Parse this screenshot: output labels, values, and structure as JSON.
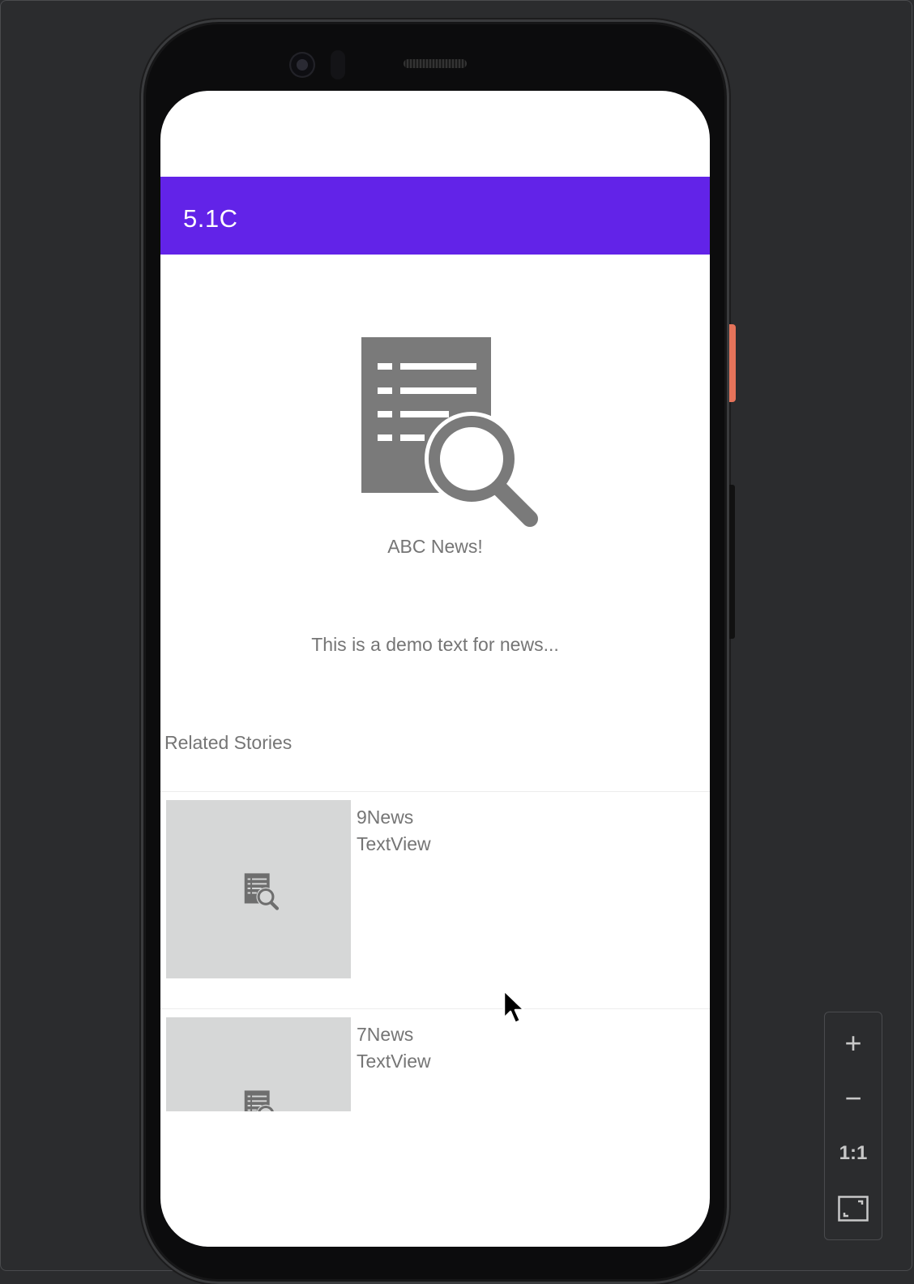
{
  "app": {
    "title": "5.1C"
  },
  "article": {
    "icon": "document-search-icon",
    "title": "ABC News!",
    "body": "This is a demo text for news..."
  },
  "related": {
    "heading": "Related Stories",
    "stories": [
      {
        "name": "9News",
        "text": "TextView",
        "thumbnail_icon": "document-search-icon"
      },
      {
        "name": "7News",
        "text": "TextView",
        "thumbnail_icon": "document-search-icon"
      }
    ]
  },
  "emulator": {
    "zoom_in_label": "+",
    "zoom_out_label": "−",
    "actual_size_label": "1:1",
    "fit_screen_icon": "fit-screen-icon"
  },
  "colors": {
    "app_bar": "#6223e8",
    "text_secondary": "#757575",
    "thumbnail_bg": "#d6d7d7",
    "icon_gray": "#7a7a7a"
  }
}
